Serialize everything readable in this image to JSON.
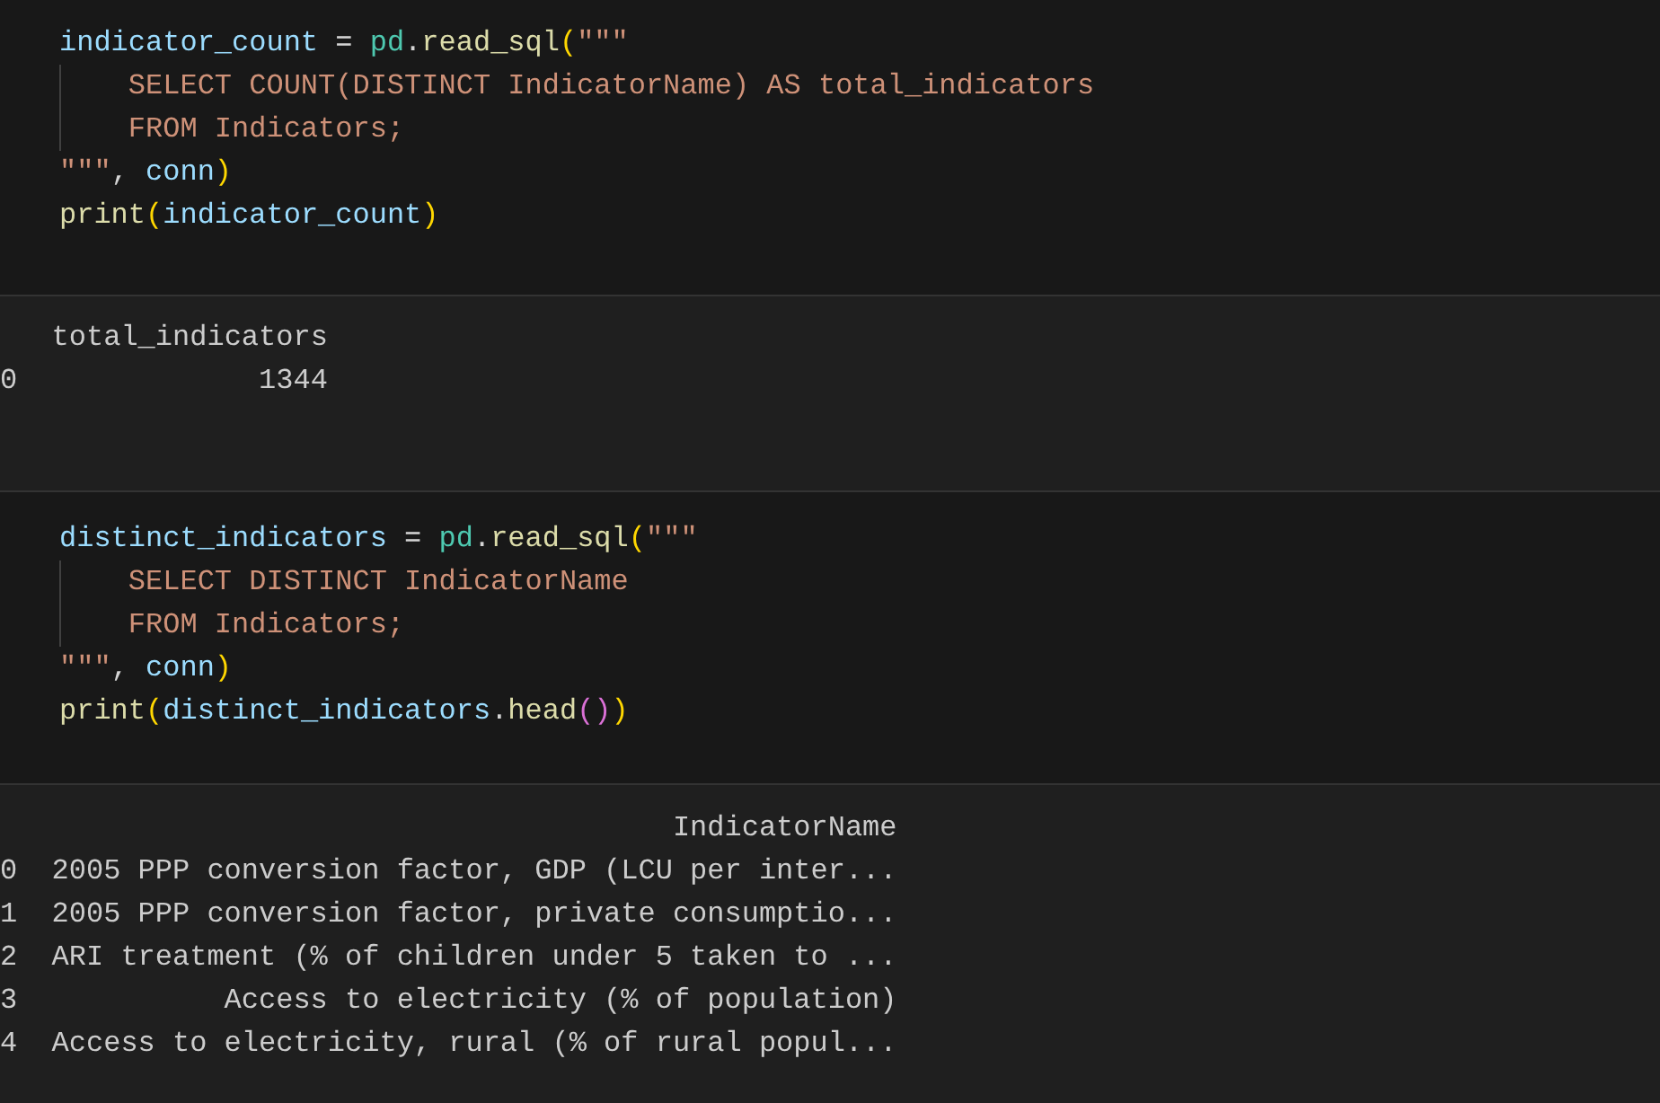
{
  "cells": [
    {
      "code": [
        {
          "guide": false,
          "tokens": [
            {
              "kind": "var",
              "text": "indicator_count"
            },
            {
              "kind": "op",
              "text": " = "
            },
            {
              "kind": "module",
              "text": "pd"
            },
            {
              "kind": "op",
              "text": "."
            },
            {
              "kind": "func",
              "text": "read_sql"
            },
            {
              "kind": "bracket",
              "text": "("
            },
            {
              "kind": "string",
              "text": "\"\"\""
            }
          ]
        },
        {
          "guide": true,
          "tokens": [
            {
              "kind": "string",
              "text": "    SELECT COUNT(DISTINCT IndicatorName) AS total_indicators"
            }
          ]
        },
        {
          "guide": true,
          "tokens": [
            {
              "kind": "string",
              "text": "    FROM Indicators;"
            }
          ]
        },
        {
          "guide": false,
          "tokens": [
            {
              "kind": "string",
              "text": "\"\"\""
            },
            {
              "kind": "op",
              "text": ", "
            },
            {
              "kind": "var",
              "text": "conn"
            },
            {
              "kind": "bracket",
              "text": ")"
            }
          ]
        },
        {
          "guide": false,
          "tokens": [
            {
              "kind": "func",
              "text": "print"
            },
            {
              "kind": "bracket",
              "text": "("
            },
            {
              "kind": "var",
              "text": "indicator_count"
            },
            {
              "kind": "bracket",
              "text": ")"
            }
          ]
        }
      ],
      "output": {
        "columns": [
          "total_indicators"
        ],
        "rows": [
          {
            "index": "0",
            "cells": [
              "1344"
            ]
          }
        ]
      }
    },
    {
      "code": [
        {
          "guide": false,
          "tokens": [
            {
              "kind": "var",
              "text": "distinct_indicators"
            },
            {
              "kind": "op",
              "text": " = "
            },
            {
              "kind": "module",
              "text": "pd"
            },
            {
              "kind": "op",
              "text": "."
            },
            {
              "kind": "func",
              "text": "read_sql"
            },
            {
              "kind": "bracket",
              "text": "("
            },
            {
              "kind": "string",
              "text": "\"\"\""
            }
          ]
        },
        {
          "guide": true,
          "tokens": [
            {
              "kind": "string",
              "text": "    SELECT DISTINCT IndicatorName"
            }
          ]
        },
        {
          "guide": true,
          "tokens": [
            {
              "kind": "string",
              "text": "    FROM Indicators;"
            }
          ]
        },
        {
          "guide": false,
          "tokens": [
            {
              "kind": "string",
              "text": "\"\"\""
            },
            {
              "kind": "op",
              "text": ", "
            },
            {
              "kind": "var",
              "text": "conn"
            },
            {
              "kind": "bracket",
              "text": ")"
            }
          ]
        },
        {
          "guide": false,
          "tokens": [
            {
              "kind": "func",
              "text": "print"
            },
            {
              "kind": "bracket",
              "text": "("
            },
            {
              "kind": "var",
              "text": "distinct_indicators"
            },
            {
              "kind": "op",
              "text": "."
            },
            {
              "kind": "func",
              "text": "head"
            },
            {
              "kind": "bracket2",
              "text": "()"
            },
            {
              "kind": "bracket",
              "text": ")"
            }
          ]
        }
      ],
      "output": {
        "columns": [
          "IndicatorName"
        ],
        "rows": [
          {
            "index": "0",
            "cells": [
              "2005 PPP conversion factor, GDP (LCU per inter..."
            ]
          },
          {
            "index": "1",
            "cells": [
              "2005 PPP conversion factor, private consumptio..."
            ]
          },
          {
            "index": "2",
            "cells": [
              "ARI treatment (% of children under 5 taken to ..."
            ]
          },
          {
            "index": "3",
            "cells": [
              "Access to electricity (% of population)"
            ]
          },
          {
            "index": "4",
            "cells": [
              "Access to electricity, rural (% of rural popul..."
            ]
          }
        ]
      }
    }
  ]
}
